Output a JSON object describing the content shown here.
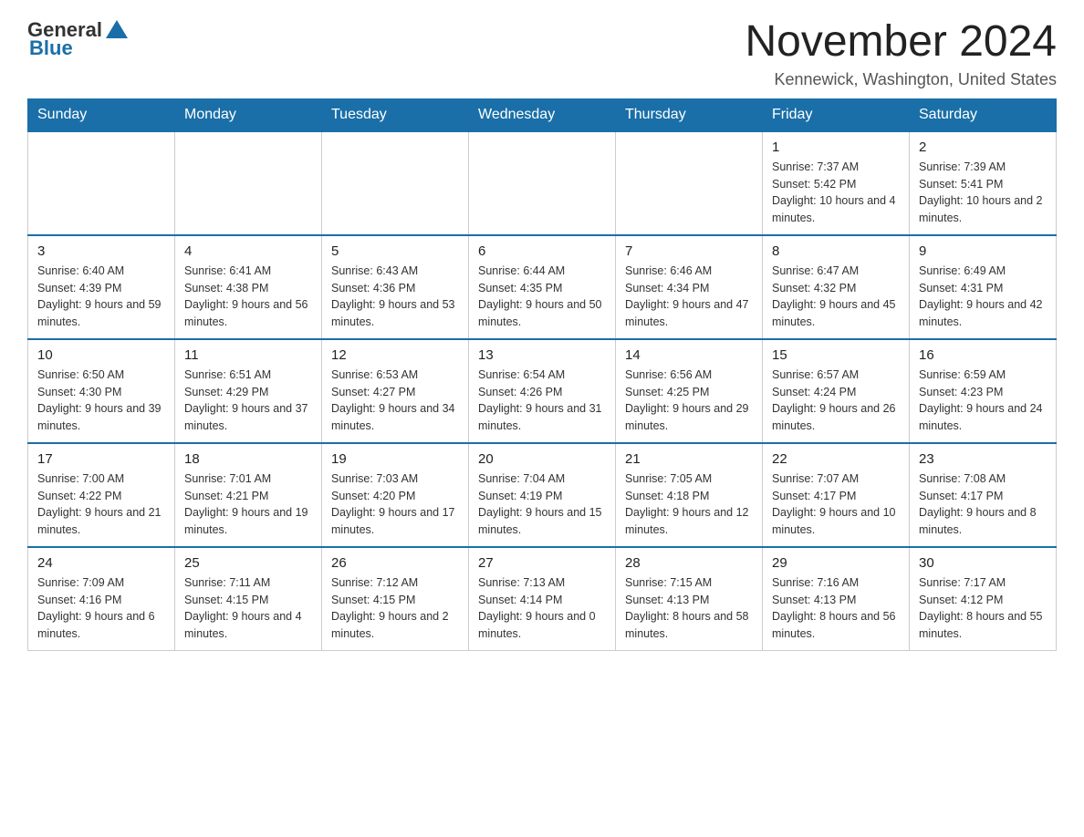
{
  "logo": {
    "general": "General",
    "blue": "Blue"
  },
  "header": {
    "title": "November 2024",
    "location": "Kennewick, Washington, United States"
  },
  "days_of_week": [
    "Sunday",
    "Monday",
    "Tuesday",
    "Wednesday",
    "Thursday",
    "Friday",
    "Saturday"
  ],
  "weeks": [
    {
      "days": [
        {
          "number": "",
          "info": ""
        },
        {
          "number": "",
          "info": ""
        },
        {
          "number": "",
          "info": ""
        },
        {
          "number": "",
          "info": ""
        },
        {
          "number": "",
          "info": ""
        },
        {
          "number": "1",
          "info": "Sunrise: 7:37 AM\nSunset: 5:42 PM\nDaylight: 10 hours and 4 minutes."
        },
        {
          "number": "2",
          "info": "Sunrise: 7:39 AM\nSunset: 5:41 PM\nDaylight: 10 hours and 2 minutes."
        }
      ]
    },
    {
      "days": [
        {
          "number": "3",
          "info": "Sunrise: 6:40 AM\nSunset: 4:39 PM\nDaylight: 9 hours and 59 minutes."
        },
        {
          "number": "4",
          "info": "Sunrise: 6:41 AM\nSunset: 4:38 PM\nDaylight: 9 hours and 56 minutes."
        },
        {
          "number": "5",
          "info": "Sunrise: 6:43 AM\nSunset: 4:36 PM\nDaylight: 9 hours and 53 minutes."
        },
        {
          "number": "6",
          "info": "Sunrise: 6:44 AM\nSunset: 4:35 PM\nDaylight: 9 hours and 50 minutes."
        },
        {
          "number": "7",
          "info": "Sunrise: 6:46 AM\nSunset: 4:34 PM\nDaylight: 9 hours and 47 minutes."
        },
        {
          "number": "8",
          "info": "Sunrise: 6:47 AM\nSunset: 4:32 PM\nDaylight: 9 hours and 45 minutes."
        },
        {
          "number": "9",
          "info": "Sunrise: 6:49 AM\nSunset: 4:31 PM\nDaylight: 9 hours and 42 minutes."
        }
      ]
    },
    {
      "days": [
        {
          "number": "10",
          "info": "Sunrise: 6:50 AM\nSunset: 4:30 PM\nDaylight: 9 hours and 39 minutes."
        },
        {
          "number": "11",
          "info": "Sunrise: 6:51 AM\nSunset: 4:29 PM\nDaylight: 9 hours and 37 minutes."
        },
        {
          "number": "12",
          "info": "Sunrise: 6:53 AM\nSunset: 4:27 PM\nDaylight: 9 hours and 34 minutes."
        },
        {
          "number": "13",
          "info": "Sunrise: 6:54 AM\nSunset: 4:26 PM\nDaylight: 9 hours and 31 minutes."
        },
        {
          "number": "14",
          "info": "Sunrise: 6:56 AM\nSunset: 4:25 PM\nDaylight: 9 hours and 29 minutes."
        },
        {
          "number": "15",
          "info": "Sunrise: 6:57 AM\nSunset: 4:24 PM\nDaylight: 9 hours and 26 minutes."
        },
        {
          "number": "16",
          "info": "Sunrise: 6:59 AM\nSunset: 4:23 PM\nDaylight: 9 hours and 24 minutes."
        }
      ]
    },
    {
      "days": [
        {
          "number": "17",
          "info": "Sunrise: 7:00 AM\nSunset: 4:22 PM\nDaylight: 9 hours and 21 minutes."
        },
        {
          "number": "18",
          "info": "Sunrise: 7:01 AM\nSunset: 4:21 PM\nDaylight: 9 hours and 19 minutes."
        },
        {
          "number": "19",
          "info": "Sunrise: 7:03 AM\nSunset: 4:20 PM\nDaylight: 9 hours and 17 minutes."
        },
        {
          "number": "20",
          "info": "Sunrise: 7:04 AM\nSunset: 4:19 PM\nDaylight: 9 hours and 15 minutes."
        },
        {
          "number": "21",
          "info": "Sunrise: 7:05 AM\nSunset: 4:18 PM\nDaylight: 9 hours and 12 minutes."
        },
        {
          "number": "22",
          "info": "Sunrise: 7:07 AM\nSunset: 4:17 PM\nDaylight: 9 hours and 10 minutes."
        },
        {
          "number": "23",
          "info": "Sunrise: 7:08 AM\nSunset: 4:17 PM\nDaylight: 9 hours and 8 minutes."
        }
      ]
    },
    {
      "days": [
        {
          "number": "24",
          "info": "Sunrise: 7:09 AM\nSunset: 4:16 PM\nDaylight: 9 hours and 6 minutes."
        },
        {
          "number": "25",
          "info": "Sunrise: 7:11 AM\nSunset: 4:15 PM\nDaylight: 9 hours and 4 minutes."
        },
        {
          "number": "26",
          "info": "Sunrise: 7:12 AM\nSunset: 4:15 PM\nDaylight: 9 hours and 2 minutes."
        },
        {
          "number": "27",
          "info": "Sunrise: 7:13 AM\nSunset: 4:14 PM\nDaylight: 9 hours and 0 minutes."
        },
        {
          "number": "28",
          "info": "Sunrise: 7:15 AM\nSunset: 4:13 PM\nDaylight: 8 hours and 58 minutes."
        },
        {
          "number": "29",
          "info": "Sunrise: 7:16 AM\nSunset: 4:13 PM\nDaylight: 8 hours and 56 minutes."
        },
        {
          "number": "30",
          "info": "Sunrise: 7:17 AM\nSunset: 4:12 PM\nDaylight: 8 hours and 55 minutes."
        }
      ]
    }
  ]
}
